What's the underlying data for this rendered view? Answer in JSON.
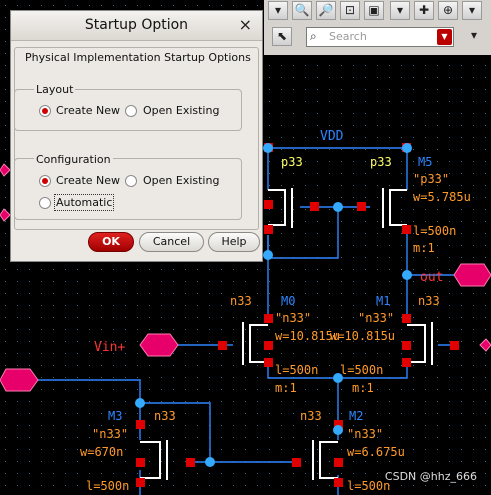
{
  "dialog": {
    "title": "Startup Option",
    "close_glyph": "×",
    "panel_label": "Physical Implementation Startup Options",
    "layout": {
      "label": "Layout",
      "options": [
        {
          "label": "Create New",
          "selected": true
        },
        {
          "label": "Open Existing",
          "selected": false
        }
      ]
    },
    "configuration": {
      "label": "Configuration",
      "options": [
        {
          "label": "Create New",
          "selected": true
        },
        {
          "label": "Open Existing",
          "selected": false
        },
        {
          "label": "Automatic",
          "selected": false
        }
      ]
    },
    "buttons": {
      "ok": "OK",
      "cancel": "Cancel",
      "help": "Help"
    }
  },
  "search": {
    "placeholder": "Search"
  },
  "schematic": {
    "net_vdd": "VDD",
    "net_out": "out",
    "net_vin": "Vin+",
    "colors": {
      "wire": "#2e86ff",
      "pin": "#e00000",
      "label_yellow": "#ffff66",
      "label_orange": "#ff9a2a",
      "net_red": "#ff3333",
      "node_cyan": "#34aaff"
    },
    "transistors": [
      {
        "name": "M5",
        "model_short": "p33",
        "model": "\"p33\"",
        "w": "w=5.785u",
        "l": "l=500n",
        "m": "m:1"
      },
      {
        "name": "",
        "model_short": "p33"
      },
      {
        "name": "M0",
        "model_short": "n33",
        "model": "\"n33\"",
        "w": "w=10.815u",
        "l": "l=500n",
        "m": "m:1"
      },
      {
        "name": "M1",
        "model_short": "n33",
        "model": "\"n33\"",
        "w": "w=10.815u",
        "l": "l=500n",
        "m": "m:1"
      },
      {
        "name": "M3",
        "model_short": "n33",
        "model": "\"n33\"",
        "w": "w=670n",
        "l": "l=500n"
      },
      {
        "name": "M2",
        "model_short": "n33",
        "model": "\"n33\"",
        "w": "w=6.675u",
        "l": "l=500n"
      }
    ]
  },
  "watermark": "CSDN @hhz_666"
}
